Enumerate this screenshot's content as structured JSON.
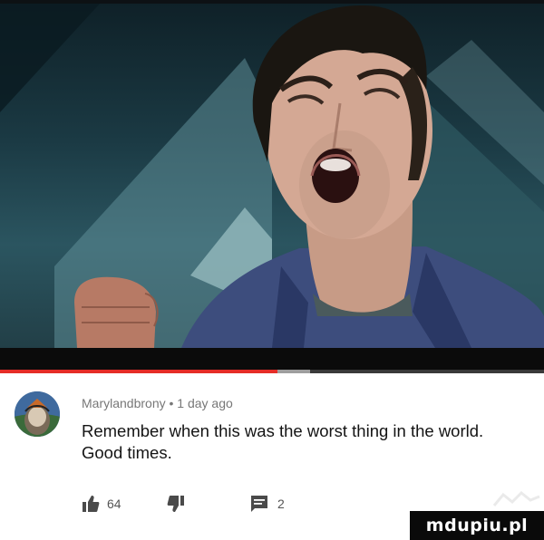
{
  "video": {
    "progress_fraction": 0.51,
    "buffer_fraction": 0.57,
    "accent_color": "#e52d27"
  },
  "comment": {
    "author": "Marylandbrony",
    "separator": "•",
    "time": "1 day ago",
    "text": "Remember when this was the worst thing in the world. Good times.",
    "like_count": "64",
    "reply_count": "2"
  },
  "icons": {
    "like": "thumbs-up-icon",
    "dislike": "thumbs-down-icon",
    "reply": "comment-icon"
  },
  "watermark": {
    "text": "mdupiu.pl"
  }
}
